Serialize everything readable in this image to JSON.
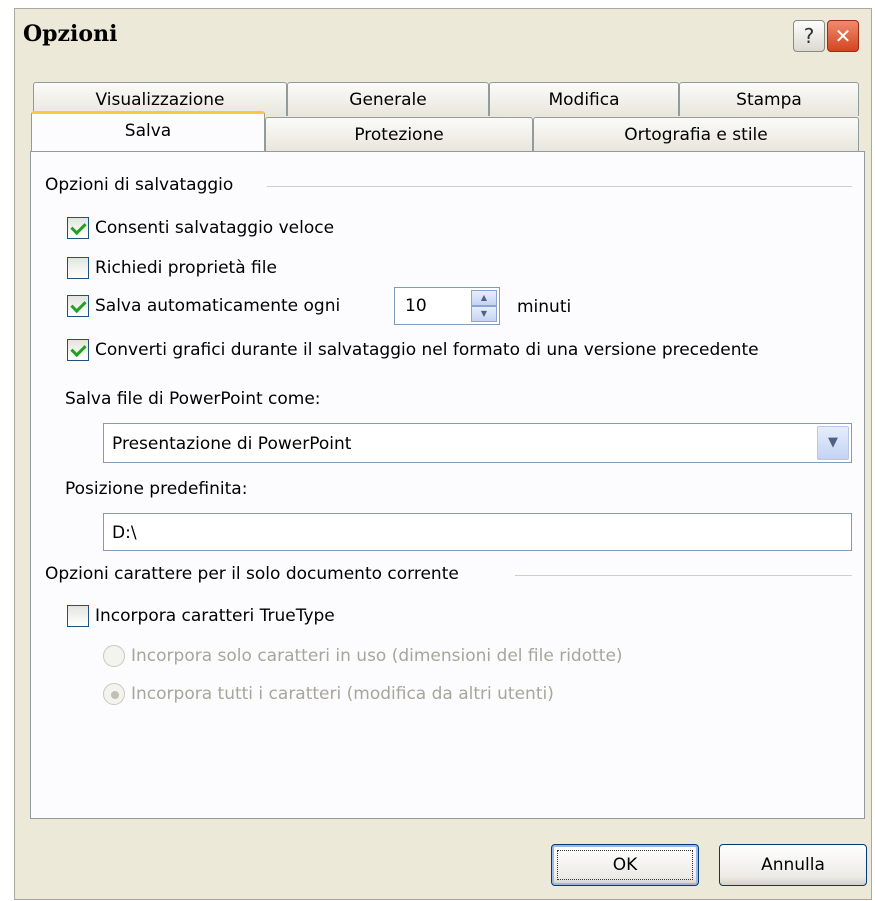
{
  "window": {
    "title": "Opzioni",
    "help_label": "?",
    "close_label": "✕"
  },
  "tabs_row1": [
    "Visualizzazione",
    "Generale",
    "Modifica",
    "Stampa"
  ],
  "tabs_row2": [
    "Salva",
    "Protezione",
    "Ortografia e stile"
  ],
  "active_tab": "Salva",
  "save_group": {
    "title": "Opzioni di salvataggio",
    "fast_save": {
      "label": "Consenti salvataggio veloce",
      "checked": true
    },
    "prompt_props": {
      "label": "Richiedi proprietà file",
      "checked": false
    },
    "autosave": {
      "label": "Salva automaticamente ogni",
      "checked": true,
      "value": "10",
      "unit": "minuti"
    },
    "convert_graphics": {
      "label": "Converti grafici durante il salvataggio nel formato di una versione precedente",
      "checked": true
    },
    "save_as_label": "Salva file di PowerPoint come:",
    "save_as_value": "Presentazione di PowerPoint",
    "default_location_label": "Posizione predefinita:",
    "default_location_value": "D:\\"
  },
  "font_group": {
    "title": "Opzioni carattere per il solo documento corrente",
    "embed_truetype": {
      "label": "Incorpora caratteri TrueType",
      "checked": false
    },
    "embed_used": {
      "label": "Incorpora solo caratteri in uso (dimensioni del file ridotte)",
      "selected": false
    },
    "embed_all": {
      "label": "Incorpora tutti i caratteri (modifica da altri utenti)",
      "selected": true
    }
  },
  "buttons": {
    "ok": "OK",
    "cancel": "Annulla"
  }
}
